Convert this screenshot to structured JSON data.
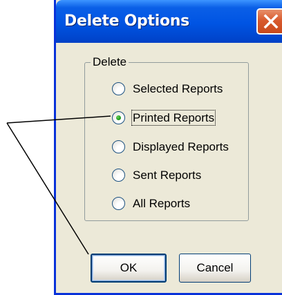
{
  "dialog": {
    "title": "Delete Options",
    "close_icon": "close-x-icon"
  },
  "group": {
    "label": "Delete",
    "options": [
      {
        "label": "Selected Reports",
        "checked": false
      },
      {
        "label": "Printed Reports",
        "checked": true
      },
      {
        "label": "Displayed Reports",
        "checked": false
      },
      {
        "label": "Sent Reports",
        "checked": false
      },
      {
        "label": "All Reports",
        "checked": false
      }
    ]
  },
  "buttons": {
    "ok_label": "OK",
    "cancel_label": "Cancel"
  },
  "colors": {
    "titlebar": "#0054e3",
    "dialog_bg": "#ece9d8",
    "close_button": "#d85a2e",
    "radio_dot": "#21a121"
  }
}
